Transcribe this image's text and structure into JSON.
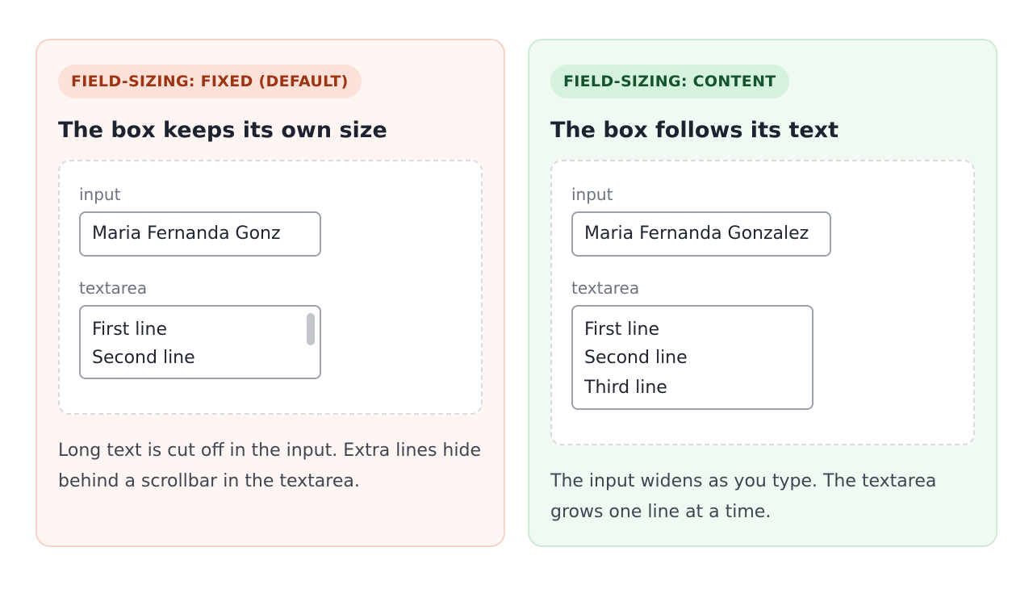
{
  "fixed": {
    "badge": "FIELD-SIZING: FIXED (DEFAULT)",
    "heading": "The box keeps its own size",
    "input_label": "input",
    "input_value": "Maria Fernanda Gonz",
    "textarea_label": "textarea",
    "textarea_lines": [
      "First line",
      "Second line"
    ],
    "description": "Long text is cut off in the input. Extra lines hide behind a scrollbar in the textarea."
  },
  "content": {
    "badge": "FIELD-SIZING: CONTENT",
    "heading": "The box follows its text",
    "input_label": "input",
    "input_value": "Maria Fernanda Gonzalez",
    "textarea_label": "textarea",
    "textarea_lines": [
      "First line",
      "Second line",
      "Third line"
    ],
    "description": "The input widens as you type. The textarea grows one line at a time."
  },
  "colors": {
    "fixed_bg": "#fff6f4",
    "fixed_badge_text": "#9a3412",
    "content_bg": "#f1f9f3",
    "content_badge_text": "#14532d"
  }
}
